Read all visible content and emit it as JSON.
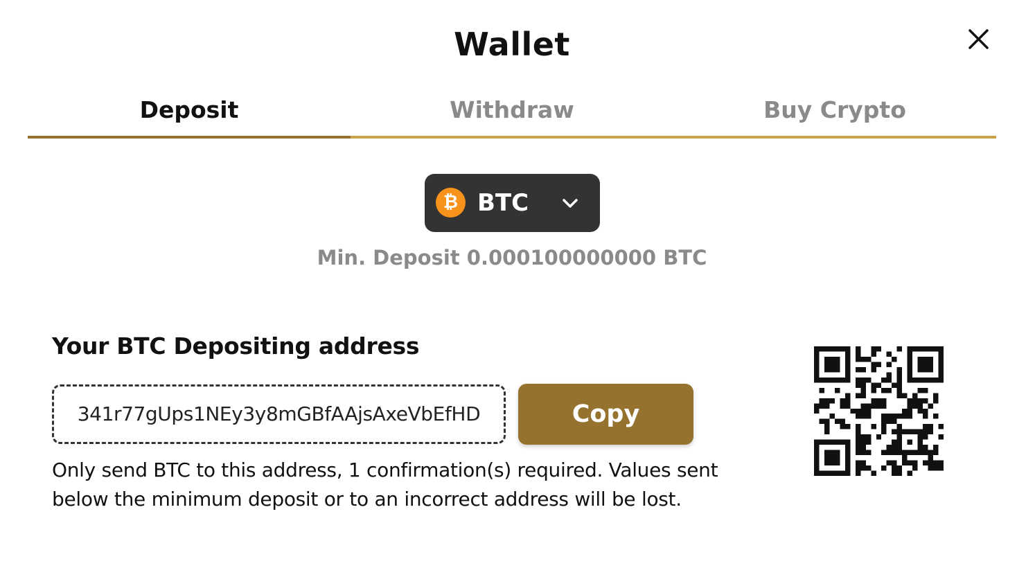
{
  "window": {
    "title": "Wallet",
    "close_icon": "close-icon"
  },
  "tabs": [
    {
      "label": "Deposit",
      "active": true
    },
    {
      "label": "Withdraw",
      "active": false
    },
    {
      "label": "Buy Crypto",
      "active": false
    }
  ],
  "coin_select": {
    "icon": "bitcoin-icon",
    "icon_glyph": "₿",
    "label": "BTC",
    "chevron_icon": "chevron-down-icon"
  },
  "min_deposit": "Min. Deposit 0.000100000000 BTC",
  "address_section": {
    "heading": "Your BTC Depositing address",
    "address": "341r77gUps1NEy3y8mGBfAAjsAxeVbEfHD",
    "copy_label": "Copy",
    "notice": "Only send BTC to this address, 1 confirmation(s) required. Values sent below the minimum deposit or to an incorrect address will be lost.",
    "qr_icon": "qr-code-icon"
  },
  "colors": {
    "accent": "#95722e",
    "tab_underline": "#c9a24b",
    "select_bg": "#333333",
    "btc_orange": "#f7931a",
    "muted_text": "#8a8a8a"
  }
}
